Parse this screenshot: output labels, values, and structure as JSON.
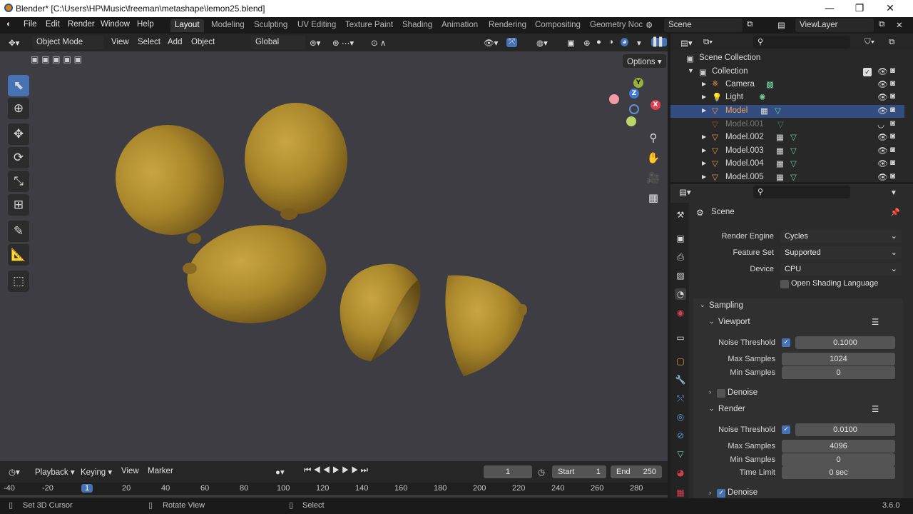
{
  "title": "Blender* [C:\\Users\\HP\\Music\\freeman\\metashape\\lemon25.blend]",
  "menus": [
    "File",
    "Edit",
    "Render",
    "Window",
    "Help"
  ],
  "workspaces": [
    "Layout",
    "Modeling",
    "Sculpting",
    "UV Editing",
    "Texture Paint",
    "Shading",
    "Animation",
    "Rendering",
    "Compositing",
    "Geometry Noc"
  ],
  "scene_name": "Scene",
  "view_layer": "ViewLayer",
  "viewport_header": {
    "mode": "Object Mode",
    "menus": [
      "View",
      "Select",
      "Add",
      "Object"
    ],
    "orientation": "Global",
    "options": "Options"
  },
  "gizmo": {
    "x": "X",
    "y": "Y",
    "z": "Z"
  },
  "outliner": {
    "root": "Scene Collection",
    "collection": "Collection",
    "items": [
      "Camera",
      "Light",
      "Model",
      "Model.001",
      "Model.002",
      "Model.003",
      "Model.004",
      "Model.005"
    ]
  },
  "properties": {
    "context": "Scene",
    "render_engine_label": "Render Engine",
    "render_engine": "Cycles",
    "feature_set_label": "Feature Set",
    "feature_set": "Supported",
    "device_label": "Device",
    "device": "CPU",
    "osl": "Open Shading Language",
    "sampling": "Sampling",
    "viewport": "Viewport",
    "render": "Render",
    "noise_threshold_label": "Noise Threshold",
    "max_samples_label": "Max Samples",
    "min_samples_label": "Min Samples",
    "time_limit_label": "Time Limit",
    "denoise": "Denoise",
    "vp_noise_threshold": "0.1000",
    "vp_max_samples": "1024",
    "vp_min_samples": "0",
    "r_noise_threshold": "0.0100",
    "r_max_samples": "4096",
    "r_min_samples": "0",
    "r_time_limit": "0 sec"
  },
  "timeline": {
    "menus": [
      "Playback",
      "Keying",
      "View",
      "Marker"
    ],
    "current_frame": "1",
    "start_label": "Start",
    "start": "1",
    "end_label": "End",
    "end": "250",
    "ticks": [
      "-40",
      "-20",
      "1",
      "20",
      "40",
      "60",
      "80",
      "100",
      "120",
      "140",
      "160",
      "180",
      "200",
      "220",
      "240",
      "260",
      "280"
    ]
  },
  "status": {
    "left": "Set 3D Cursor",
    "middle": "Rotate View",
    "right": "Select",
    "version": "3.6.0"
  }
}
